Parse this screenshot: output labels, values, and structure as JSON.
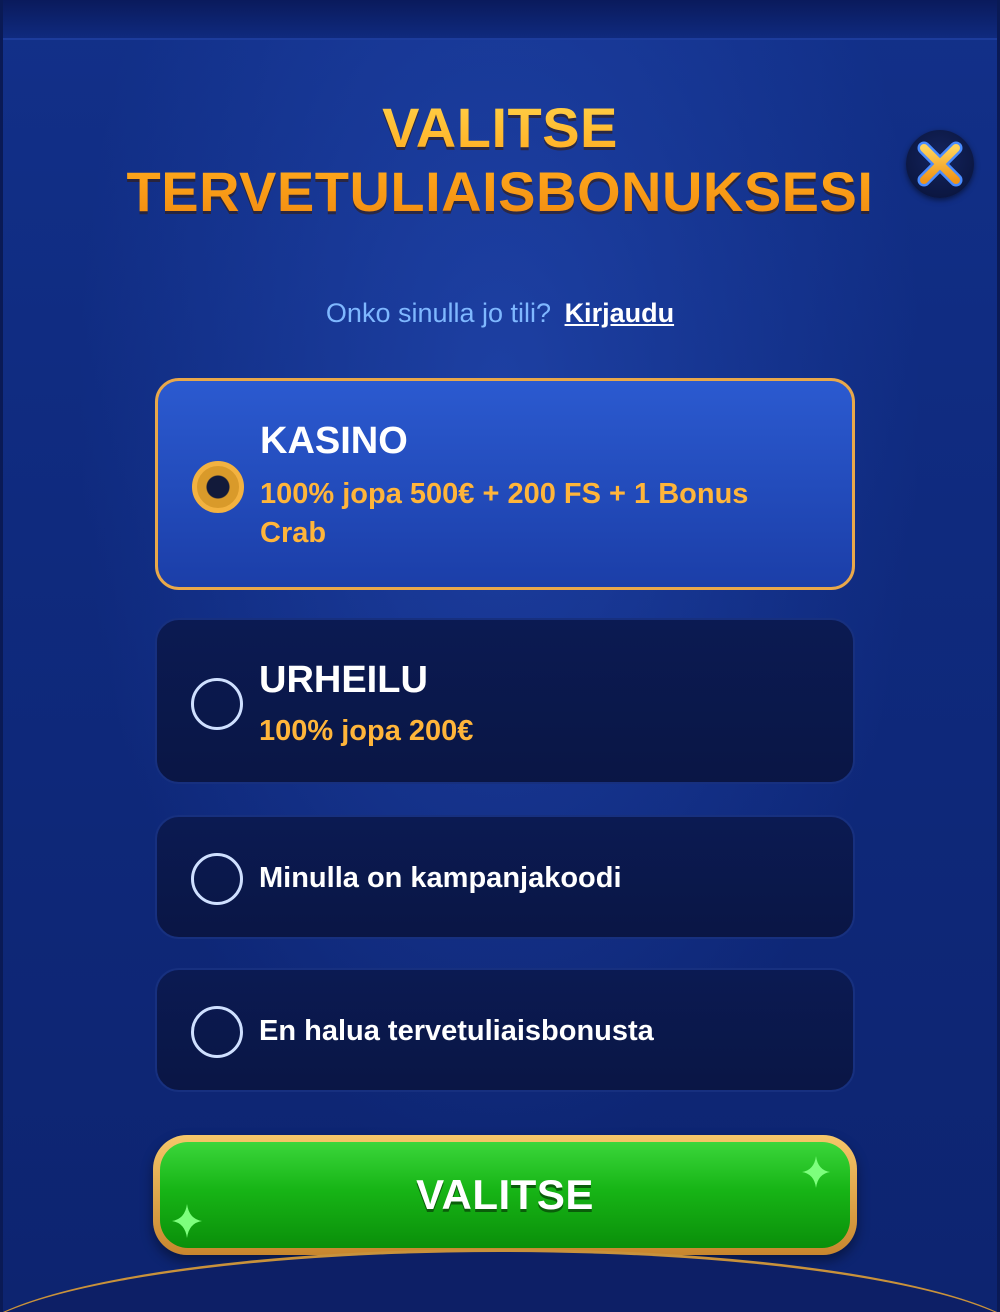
{
  "modal": {
    "title_line1": "VALITSE",
    "title_line2": "TERVETULIAISBONUKSESI",
    "close_icon": "close-x-icon"
  },
  "login": {
    "question": "Onko sinulla jo tili?",
    "link": "Kirjaudu"
  },
  "options": [
    {
      "title": "KASINO",
      "desc": "100% jopa 500€ + 200 FS + 1 Bonus Crab",
      "selected": true
    },
    {
      "title": "URHEILU",
      "desc": "100% jopa 200€",
      "selected": false
    },
    {
      "label": "Minulla on kampanjakoodi",
      "selected": false
    },
    {
      "label": "En halua tervetuliaisbonusta",
      "selected": false
    }
  ],
  "cta": {
    "label": "VALITSE"
  },
  "colors": {
    "title_gold": "#ffb320",
    "accent_orange": "#ffb53a",
    "selected_border": "#e9a84a",
    "cta_green": "#17b516",
    "link_blue": "#7fb8ff"
  }
}
